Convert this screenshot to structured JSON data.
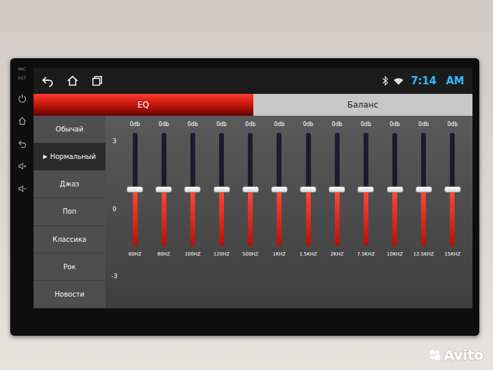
{
  "device": {
    "labels": [
      "MIC",
      "RST"
    ]
  },
  "status_bar": {
    "time": "7:14",
    "period": "AM",
    "bluetooth": true,
    "wifi": true
  },
  "tabs": [
    {
      "label": "EQ",
      "selected": true
    },
    {
      "label": "Баланс",
      "selected": false
    }
  ],
  "sidebar": {
    "marker": "▶",
    "items": [
      {
        "label": "Обычай",
        "selected": false
      },
      {
        "label": "Нормальный",
        "selected": true
      },
      {
        "label": "Джаз",
        "selected": false
      },
      {
        "label": "Поп",
        "selected": false
      },
      {
        "label": "Классика",
        "selected": false
      },
      {
        "label": "Рок",
        "selected": false
      },
      {
        "label": "Новости",
        "selected": false
      }
    ]
  },
  "equalizer": {
    "scale": [
      "3",
      "0",
      "-3"
    ],
    "bands": [
      {
        "label": "60HZ",
        "reading": "0db",
        "level": 0.5
      },
      {
        "label": "80HZ",
        "reading": "0db",
        "level": 0.5
      },
      {
        "label": "100HZ",
        "reading": "0db",
        "level": 0.5
      },
      {
        "label": "120HZ",
        "reading": "0db",
        "level": 0.5
      },
      {
        "label": "500HZ",
        "reading": "0db",
        "level": 0.5
      },
      {
        "label": "1KHZ",
        "reading": "0db",
        "level": 0.5
      },
      {
        "label": "1.5KHZ",
        "reading": "0db",
        "level": 0.5
      },
      {
        "label": "2KHZ",
        "reading": "0db",
        "level": 0.5
      },
      {
        "label": "7.5KHZ",
        "reading": "0db",
        "level": 0.5
      },
      {
        "label": "10KHZ",
        "reading": "0db",
        "level": 0.5
      },
      {
        "label": "12.5KHZ",
        "reading": "0db",
        "level": 0.5
      },
      {
        "label": "15KHZ",
        "reading": "0db",
        "level": 0.5
      }
    ]
  },
  "watermark": "Avito"
}
